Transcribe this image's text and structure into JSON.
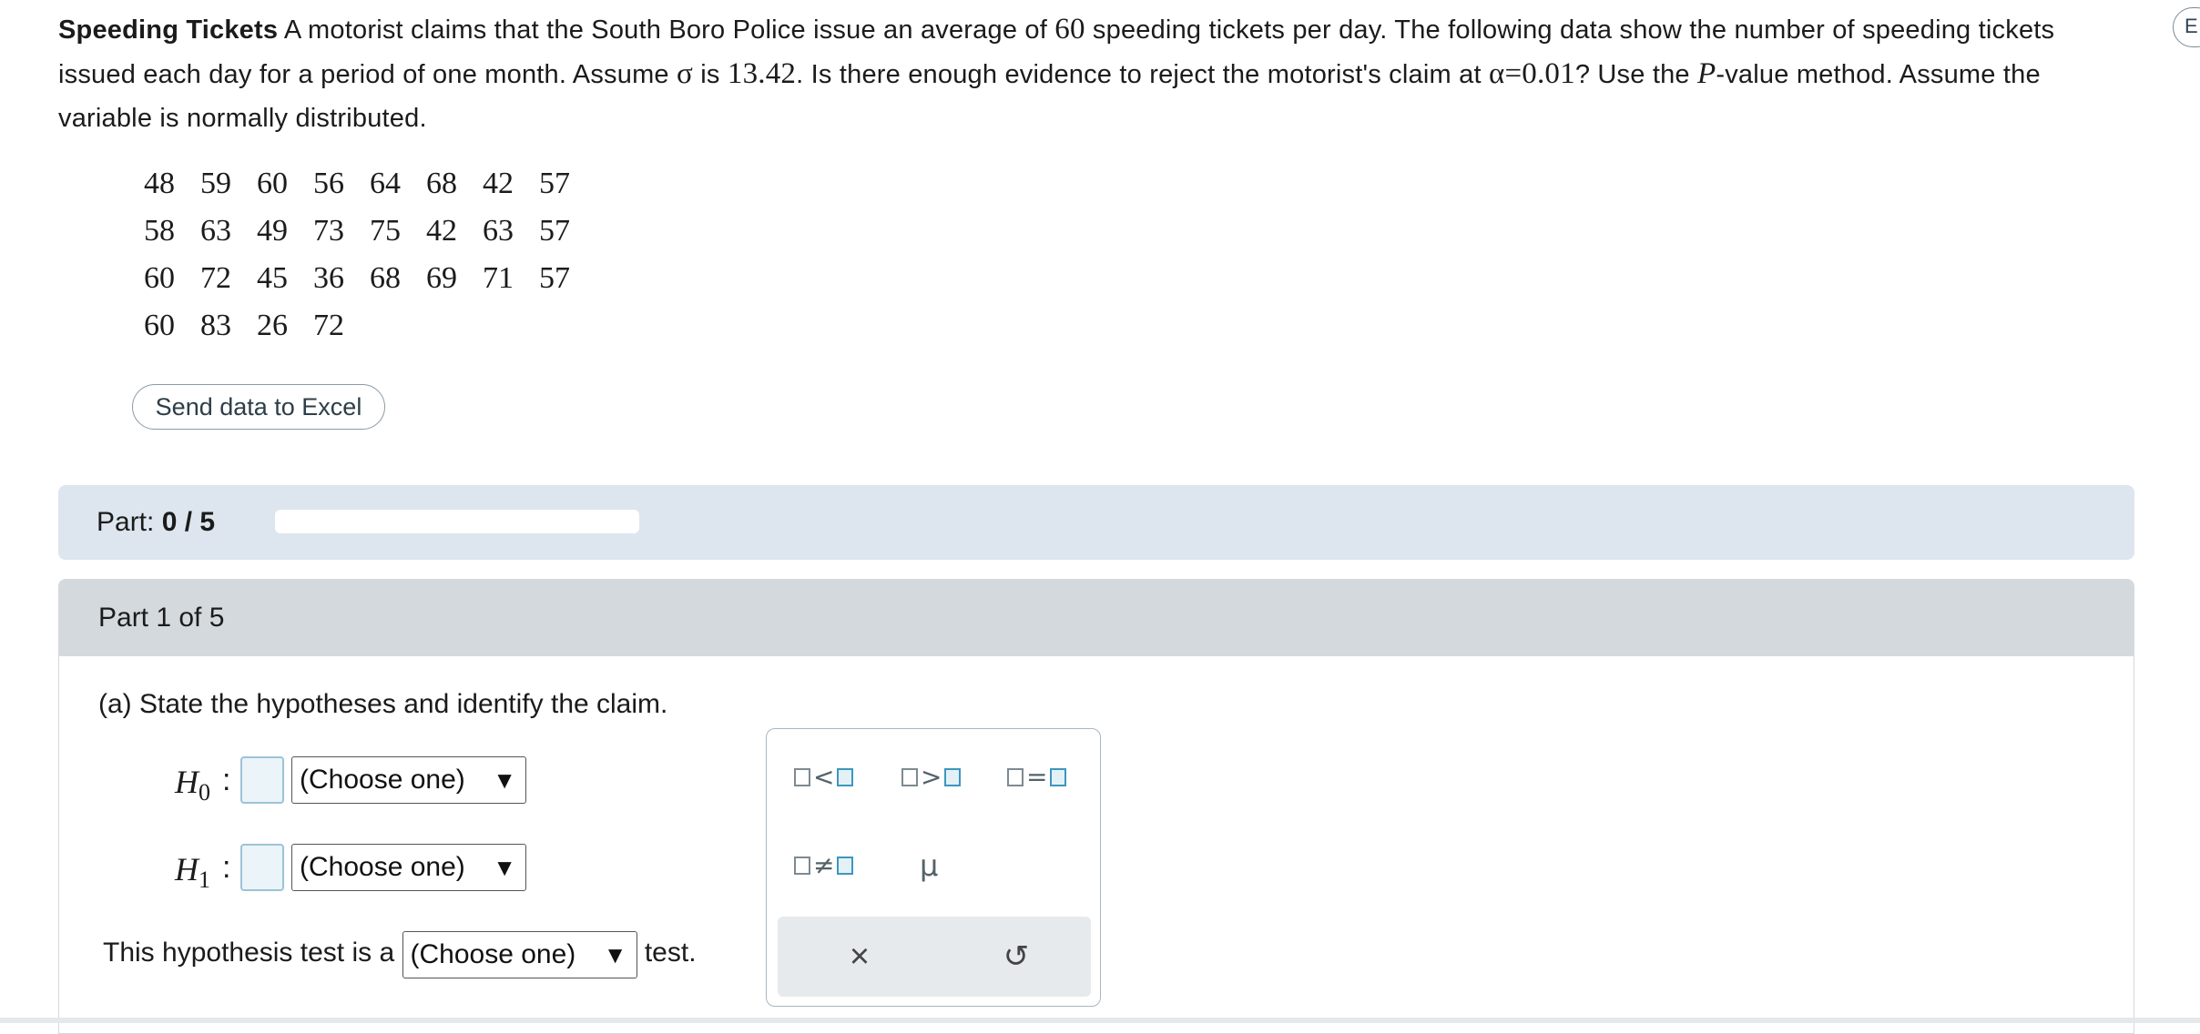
{
  "problem": {
    "title": "Speeding Tickets",
    "seg1": " A motorist claims that the South Boro Police issue an average of ",
    "num_avg": "60",
    "seg2": " speeding tickets per day. The following data show the number of speeding tickets issued each day for a period of one month. Assume ",
    "sigma": "σ",
    "seg3": " is ",
    "sigma_val": "13.42",
    "seg4": ". Is there enough evidence to reject the motorist's claim at ",
    "alpha_expr": "α=0.01",
    "seg5": "? Use the ",
    "p_letter": "P",
    "seg6": "-value method. Assume the variable is normally distributed."
  },
  "data_rows": [
    [
      "48",
      "59",
      "60",
      "56",
      "64",
      "68",
      "42",
      "57"
    ],
    [
      "58",
      "63",
      "49",
      "73",
      "75",
      "42",
      "63",
      "57"
    ],
    [
      "60",
      "72",
      "45",
      "36",
      "68",
      "69",
      "71",
      "57"
    ],
    [
      "60",
      "83",
      "26",
      "72"
    ]
  ],
  "excel_button": "Send data to Excel",
  "edge_button": "E",
  "part_bar": {
    "label": "Part:",
    "progress_text": "0 / 5",
    "progress_fraction": 0
  },
  "part_section": {
    "header": "Part 1 of 5",
    "question": "(a) State the hypotheses and identify the claim.",
    "h0": {
      "letter": "H",
      "sub": "0",
      "colon": ":"
    },
    "h1": {
      "letter": "H",
      "sub": "1",
      "colon": ":"
    },
    "choose": "(Choose one)",
    "arrow": "▼",
    "test_prefix": "This hypothesis test is a",
    "test_suffix": "test."
  },
  "palette": {
    "lt": "<",
    "gt": ">",
    "eq": "=",
    "ne": "≠",
    "mu": "μ",
    "clear_icon": "×",
    "reset_icon": "↺"
  }
}
